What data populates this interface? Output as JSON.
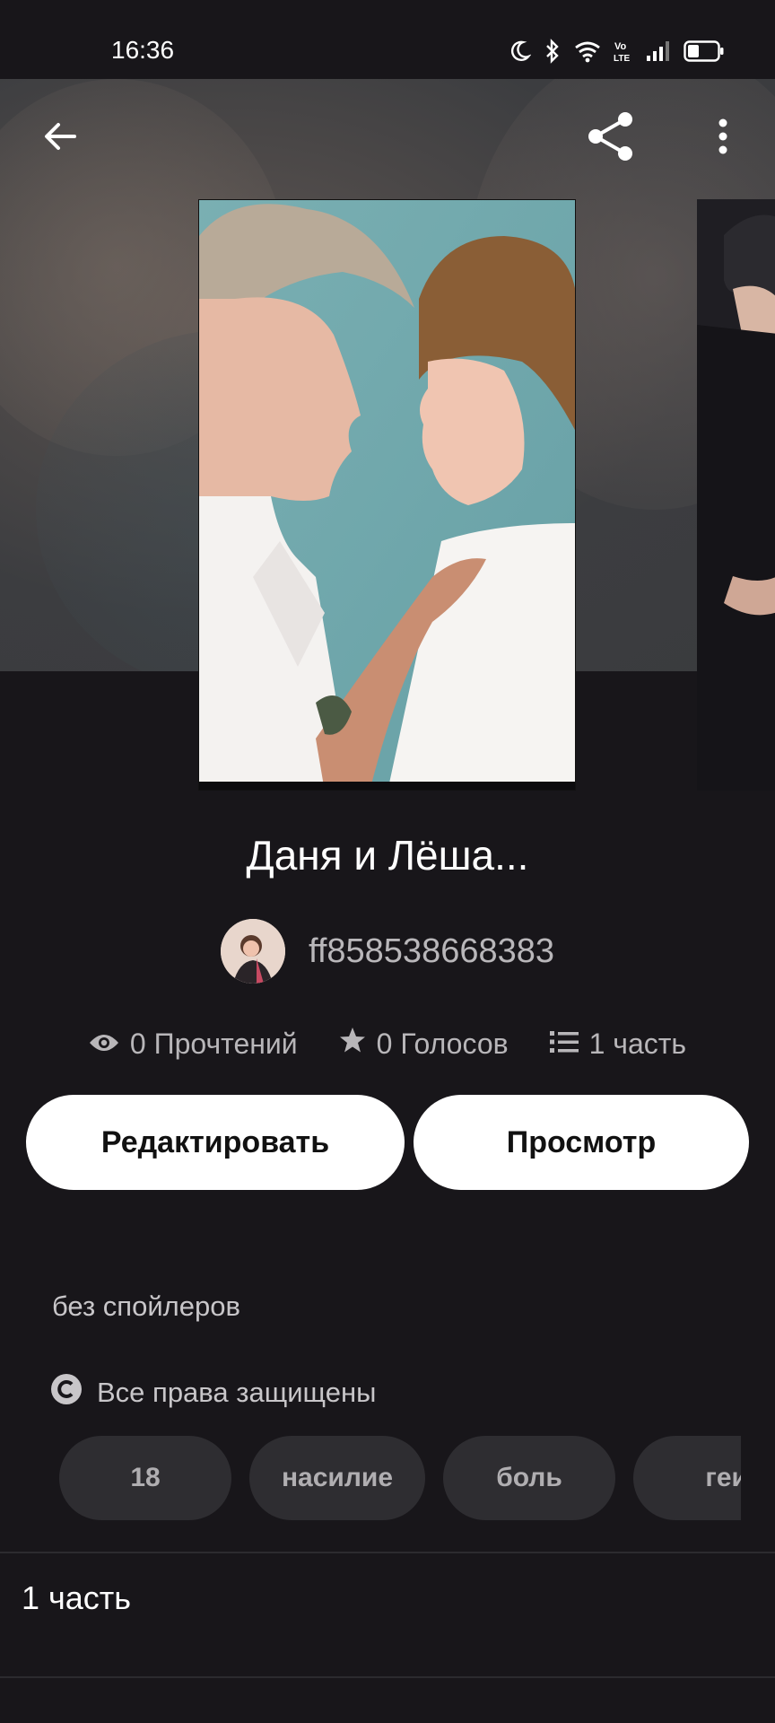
{
  "status_bar": {
    "time": "16:36",
    "icons": [
      "moon-icon",
      "bluetooth-icon",
      "wifi-icon",
      "volte-icon",
      "signal-icon",
      "battery-icon"
    ],
    "volte_label": "Vo\nLTE"
  },
  "topbar": {
    "icons": [
      "back-arrow-icon",
      "share-icon",
      "more-vertical-icon"
    ]
  },
  "story": {
    "title": "Даня и Лёша...",
    "author": "ff858538668383",
    "reads": "0 Прочтений",
    "votes": "0 Голосов",
    "parts": "1 часть",
    "description": "без спойлеров",
    "copyright": "Все права защищены"
  },
  "actions": {
    "edit_label": "Редактировать",
    "view_label": "Просмотр"
  },
  "tags": [
    "18",
    "насилие",
    "боль",
    "геи"
  ],
  "parts_section": {
    "label": "1 часть"
  },
  "colors": {
    "background": "#18161a",
    "button_bg": "#ffffff",
    "tag_bg": "#2e2d31",
    "muted_text": "#b8b6b9"
  }
}
